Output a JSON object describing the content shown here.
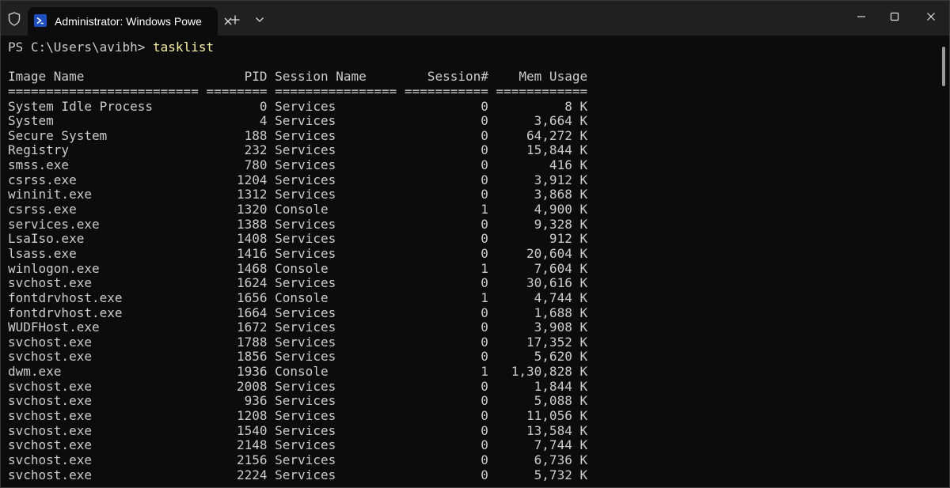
{
  "tab": {
    "title": "Administrator: Windows PowerShell"
  },
  "terminal": {
    "prompt": "PS C:\\Users\\avibh> ",
    "command": "tasklist",
    "header": "Image Name                     PID Session Name        Session#    Mem Usage",
    "separator": "========================= ======== ================ =========== ============",
    "rows": [
      "System Idle Process              0 Services                   0          8 K",
      "System                           4 Services                   0      3,664 K",
      "Secure System                  188 Services                   0     64,272 K",
      "Registry                       232 Services                   0     15,844 K",
      "smss.exe                       780 Services                   0        416 K",
      "csrss.exe                     1204 Services                   0      3,912 K",
      "wininit.exe                   1312 Services                   0      3,868 K",
      "csrss.exe                     1320 Console                    1      4,900 K",
      "services.exe                  1388 Services                   0      9,328 K",
      "LsaIso.exe                    1408 Services                   0        912 K",
      "lsass.exe                     1416 Services                   0     20,604 K",
      "winlogon.exe                  1468 Console                    1      7,604 K",
      "svchost.exe                   1624 Services                   0     30,616 K",
      "fontdrvhost.exe               1656 Console                    1      4,744 K",
      "fontdrvhost.exe               1664 Services                   0      1,688 K",
      "WUDFHost.exe                  1672 Services                   0      3,908 K",
      "svchost.exe                   1788 Services                   0     17,352 K",
      "svchost.exe                   1856 Services                   0      5,620 K",
      "dwm.exe                       1936 Console                    1   1,30,828 K",
      "svchost.exe                   2008 Services                   0      1,844 K",
      "svchost.exe                    936 Services                   0      5,088 K",
      "svchost.exe                   1208 Services                   0     11,056 K",
      "svchost.exe                   1540 Services                   0     13,584 K",
      "svchost.exe                   2148 Services                   0      7,744 K",
      "svchost.exe                   2156 Services                   0      6,736 K",
      "svchost.exe                   2224 Services                   0      5,732 K"
    ]
  },
  "colors": {
    "background": "#0c0c0c",
    "titlebar": "#202020",
    "text": "#cccccc",
    "command": "#f9f1a5",
    "powershell_icon": "#1f4fbf"
  },
  "icons": {
    "shield": "shield-icon",
    "powershell": "powershell-icon",
    "close_tab": "close-icon",
    "new_tab": "plus-icon",
    "dropdown": "chevron-down-icon",
    "minimize": "minimize-icon",
    "maximize": "maximize-icon",
    "close_window": "close-icon"
  }
}
